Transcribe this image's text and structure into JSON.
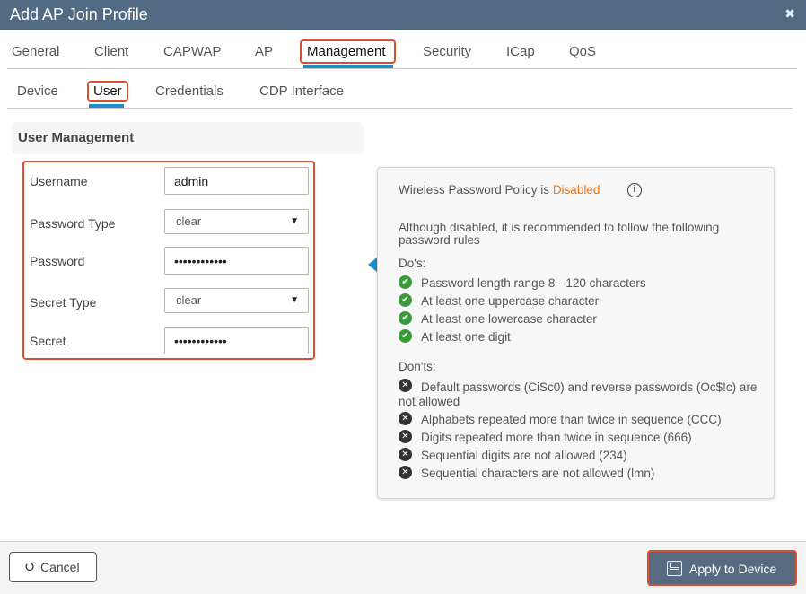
{
  "window": {
    "title": "Add AP Join Profile",
    "close_glyph": "✖"
  },
  "tabs_primary": [
    {
      "label": "General"
    },
    {
      "label": "Client"
    },
    {
      "label": "CAPWAP"
    },
    {
      "label": "AP"
    },
    {
      "label": "Management"
    },
    {
      "label": "Security"
    },
    {
      "label": "ICap"
    },
    {
      "label": "QoS"
    }
  ],
  "tabs_secondary": [
    {
      "label": "Device"
    },
    {
      "label": "User"
    },
    {
      "label": "Credentials"
    },
    {
      "label": "CDP Interface"
    }
  ],
  "active": {
    "primary": "Management",
    "secondary": "User"
  },
  "section": {
    "title": "User Management"
  },
  "form": {
    "username": {
      "label": "Username",
      "value": "admin"
    },
    "password_type": {
      "label": "Password Type",
      "value": "clear"
    },
    "password": {
      "label": "Password",
      "value": "••••••••••••"
    },
    "secret_type": {
      "label": "Secret Type",
      "value": "clear"
    },
    "secret": {
      "label": "Secret",
      "value": "••••••••••••"
    }
  },
  "policy": {
    "heading_prefix": "Wireless Password Policy is",
    "status": "Disabled",
    "info_glyph": "i",
    "note": "Although disabled, it is recommended to follow the following password rules",
    "dos_title": "Do's:",
    "dos": [
      "Password length range 8 - 120 characters",
      "At least one uppercase character",
      "At least one lowercase character",
      "At least one digit"
    ],
    "donts_title": "Don'ts:",
    "donts": [
      "Default passwords (CiSc0) and reverse passwords (Oc$!c) are not allowed",
      "Alphabets repeated more than twice in sequence (CCC)",
      "Digits repeated more than twice in sequence (666)",
      "Sequential digits are not allowed (234)",
      "Sequential characters are not allowed (lmn)"
    ]
  },
  "footer": {
    "cancel_label": "Cancel",
    "apply_label": "Apply to Device"
  },
  "colors": {
    "titlebar": "#526a82",
    "accent_blue": "#1a8ec8",
    "highlight": "#d9502f",
    "disabled_text": "#e8741c",
    "ok_green": "#3a9a3a",
    "apply_button": "#566b80"
  },
  "icons": {
    "ok": "check-circle-icon",
    "dont": "x-circle-icon",
    "cancel": "undo-icon",
    "apply": "save-icon",
    "info": "info-icon"
  }
}
